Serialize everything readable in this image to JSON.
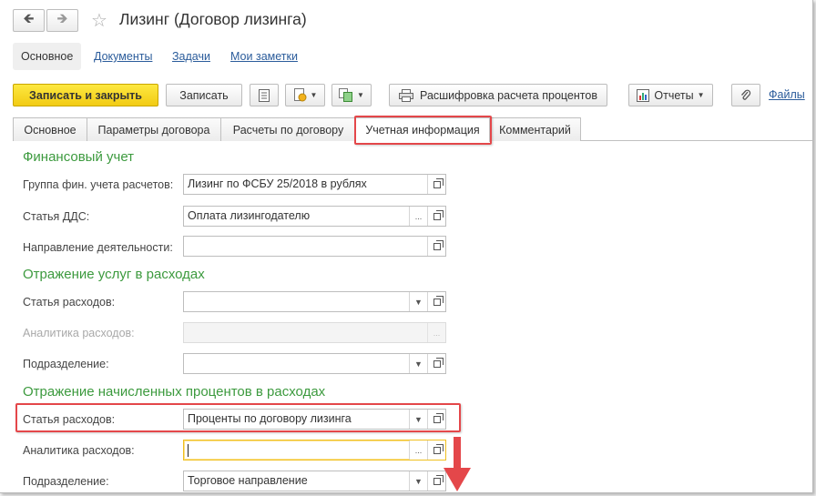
{
  "window": {
    "title": "Лизинг (Договор лизинга)"
  },
  "nav": {
    "back_icon": "arrow-left",
    "forward_icon": "arrow-right",
    "favorite_icon": "star"
  },
  "view_tabs": [
    {
      "label": "Основное",
      "active": true
    },
    {
      "label": "Документы"
    },
    {
      "label": "Задачи"
    },
    {
      "label": "Мои заметки"
    }
  ],
  "toolbar": {
    "save_close": "Записать и закрыть",
    "save": "Записать",
    "interest_breakdown": "Расшифровка расчета процентов",
    "reports": "Отчеты",
    "files": "Файлы"
  },
  "tabs": [
    {
      "label": "Основное"
    },
    {
      "label": "Параметры договора"
    },
    {
      "label": "Расчеты по договору"
    },
    {
      "label": "Учетная информация",
      "active": true
    },
    {
      "label": "Комментарий"
    }
  ],
  "sections": {
    "financial": {
      "title": "Финансовый учет",
      "fields": [
        {
          "label": "Группа фин. учета расчетов:",
          "value": "Лизинг по ФСБУ 25/2018 в рублях"
        },
        {
          "label": "Статья ДДС:",
          "value": "Оплата лизингодателю"
        },
        {
          "label": "Направление деятельности:",
          "value": ""
        }
      ]
    },
    "services": {
      "title": "Отражение услуг в расходах",
      "fields": [
        {
          "label": "Статья расходов:",
          "value": ""
        },
        {
          "label": "Аналитика расходов:",
          "value": "",
          "disabled": true
        },
        {
          "label": "Подразделение:",
          "value": ""
        }
      ]
    },
    "interest": {
      "title": "Отражение начисленных процентов в расходах",
      "fields": [
        {
          "label": "Статья расходов:",
          "value": "Проценты по договору лизинга"
        },
        {
          "label": "Аналитика расходов:",
          "value": ""
        },
        {
          "label": "Подразделение:",
          "value": "Торговое направление"
        }
      ]
    }
  },
  "colors": {
    "section_title": "#3c9a3e",
    "primary_button": "#f5d01a",
    "highlight": "#e4474a",
    "link": "#2b5c9b"
  }
}
